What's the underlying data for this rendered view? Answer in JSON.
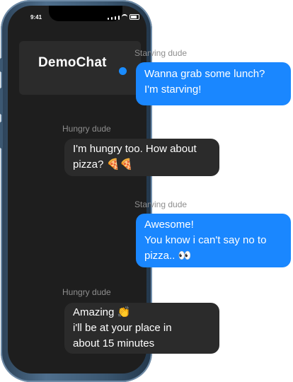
{
  "status_bar": {
    "time": "9:41"
  },
  "app": {
    "title": "DemoChat",
    "accent_color": "#1a87ff"
  },
  "messages": [
    {
      "sender": "Starving dude",
      "direction": "outgoing",
      "lines": [
        "Wanna grab some lunch?",
        "I'm starving!"
      ]
    },
    {
      "sender": "Hungry dude",
      "direction": "incoming",
      "lines": [
        "I'm hungry too. How about",
        "pizza? 🍕🍕"
      ]
    },
    {
      "sender": "Starving dude",
      "direction": "outgoing",
      "lines": [
        "Awesome!",
        "You know i can't say no to",
        "pizza.. 👀"
      ]
    },
    {
      "sender": "Hungry dude",
      "direction": "incoming",
      "lines": [
        "Amazing 👏",
        "i'll be at your place in",
        "about 15 minutes"
      ]
    }
  ]
}
